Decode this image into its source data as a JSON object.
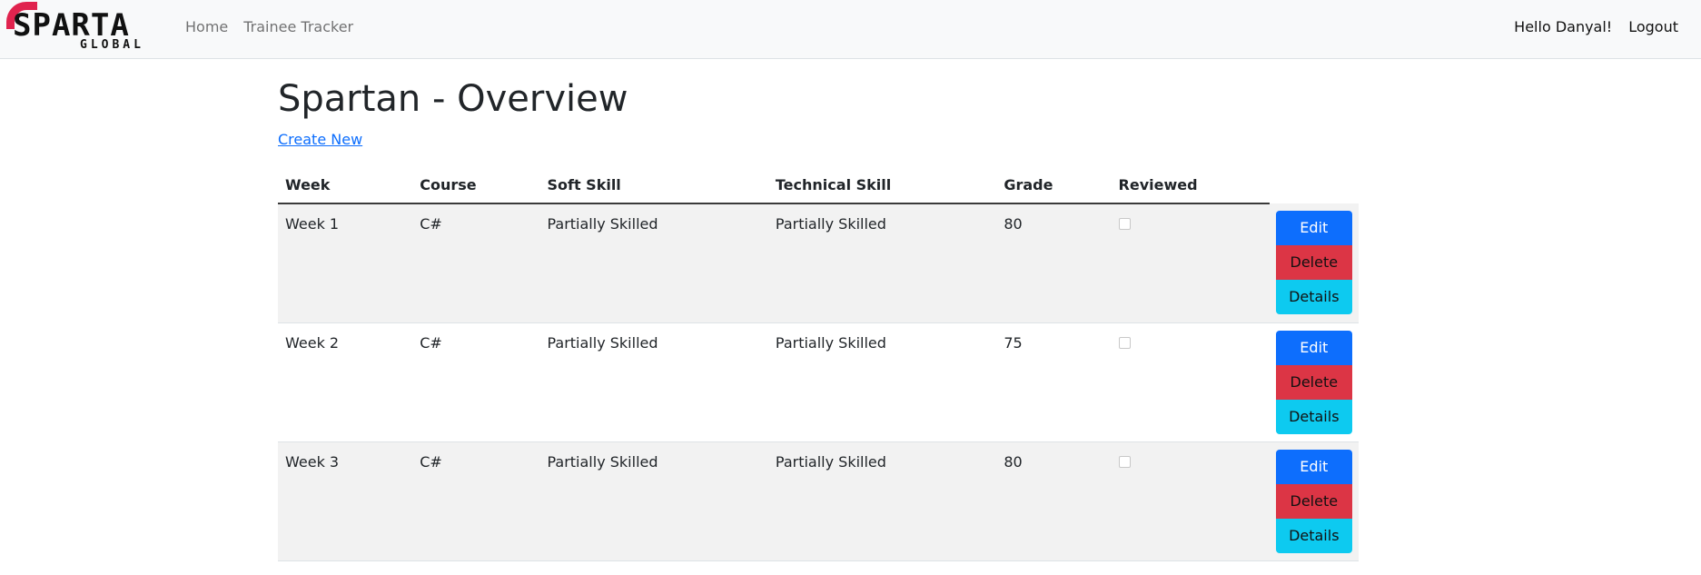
{
  "nav": {
    "logo_main": "SPARTA",
    "logo_sub": "GLOBAL",
    "links": [
      "Home",
      "Trainee Tracker"
    ],
    "greeting": "Hello Danyal!",
    "logout": "Logout"
  },
  "page": {
    "title": "Spartan - Overview",
    "create_new": "Create New"
  },
  "table": {
    "columns": [
      "Week",
      "Course",
      "Soft Skill",
      "Technical Skill",
      "Grade",
      "Reviewed"
    ],
    "rows": [
      {
        "week": "Week 1",
        "course": "C#",
        "soft_skill": "Partially Skilled",
        "technical_skill": "Partially Skilled",
        "grade": "80",
        "reviewed": false
      },
      {
        "week": "Week 2",
        "course": "C#",
        "soft_skill": "Partially Skilled",
        "technical_skill": "Partially Skilled",
        "grade": "75",
        "reviewed": false
      },
      {
        "week": "Week 3",
        "course": "C#",
        "soft_skill": "Partially Skilled",
        "technical_skill": "Partially Skilled",
        "grade": "80",
        "reviewed": false
      }
    ],
    "actions": {
      "edit": "Edit",
      "delete": "Delete",
      "details": "Details"
    }
  },
  "colors": {
    "primary": "#0d6efd",
    "danger": "#dc3545",
    "info": "#0dcaf0",
    "brand": "#e0234e"
  }
}
